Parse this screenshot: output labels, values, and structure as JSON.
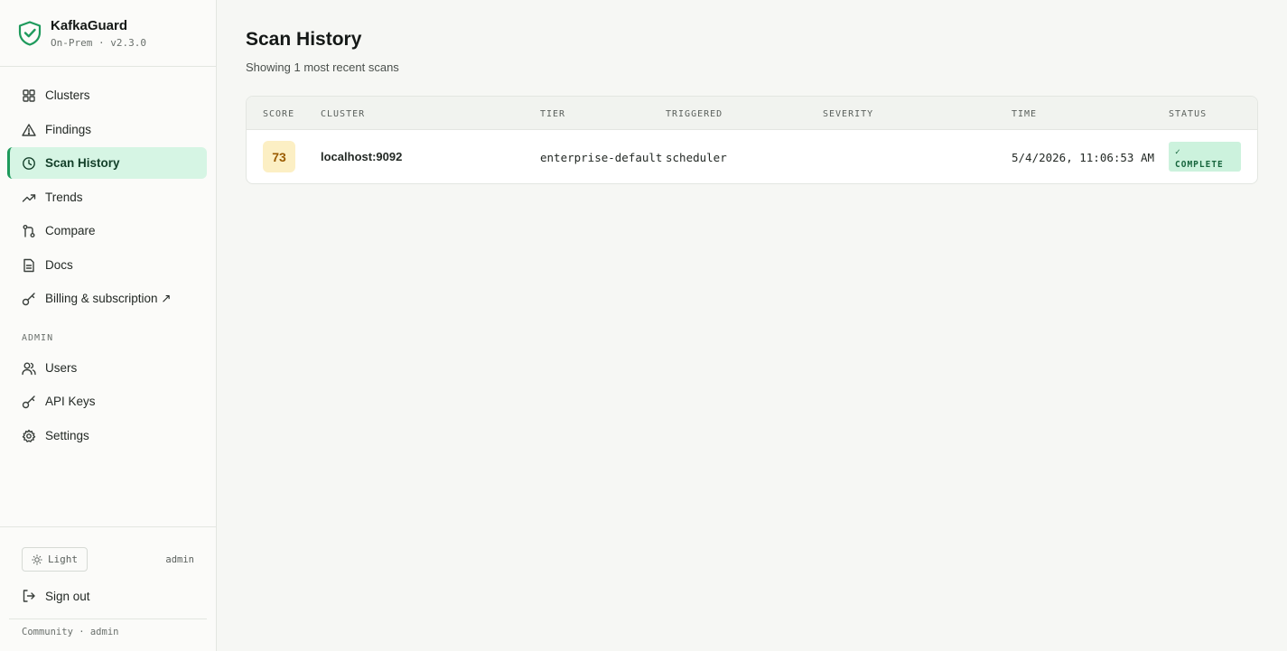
{
  "brand": {
    "name": "KafkaGuard",
    "version": "On-Prem · v2.3.0",
    "accent": "#1e9a5c"
  },
  "nav": {
    "items": [
      {
        "label": "Clusters",
        "icon": "grid-icon"
      },
      {
        "label": "Findings",
        "icon": "warning-triangle-icon"
      },
      {
        "label": "Scan History",
        "icon": "clock-icon",
        "active": true
      },
      {
        "label": "Trends",
        "icon": "trend-up-icon"
      },
      {
        "label": "Compare",
        "icon": "compare-icon"
      },
      {
        "label": "Docs",
        "icon": "document-icon"
      },
      {
        "label": "Billing & subscription ↗",
        "icon": "key-icon"
      }
    ],
    "admin_label": "ADMIN",
    "admin_items": [
      {
        "label": "Users",
        "icon": "users-icon"
      },
      {
        "label": "API Keys",
        "icon": "key-icon"
      },
      {
        "label": "Settings",
        "icon": "gear-icon"
      }
    ]
  },
  "footer": {
    "theme_label": "Light",
    "user": "admin",
    "signout_label": "Sign out",
    "plan_text": "Community · admin"
  },
  "page": {
    "title": "Scan History",
    "subtitle": "Showing 1 most recent scans"
  },
  "table": {
    "headers": [
      "SCORE",
      "CLUSTER",
      "TIER",
      "TRIGGERED",
      "SEVERITY",
      "TIME",
      "STATUS"
    ],
    "rows": [
      {
        "score": "73",
        "cluster": "localhost:9092",
        "tier": "enterprise-default",
        "triggered": "scheduler",
        "severity": "",
        "time": "5/4/2026, 11:06:53 AM",
        "status_check": "✓",
        "status": "COMPLETE"
      }
    ]
  },
  "colors": {
    "score_bg": "#fcefc4",
    "score_fg": "#9a5b00",
    "status_bg": "#ccf2dd",
    "status_fg": "#17653d"
  }
}
